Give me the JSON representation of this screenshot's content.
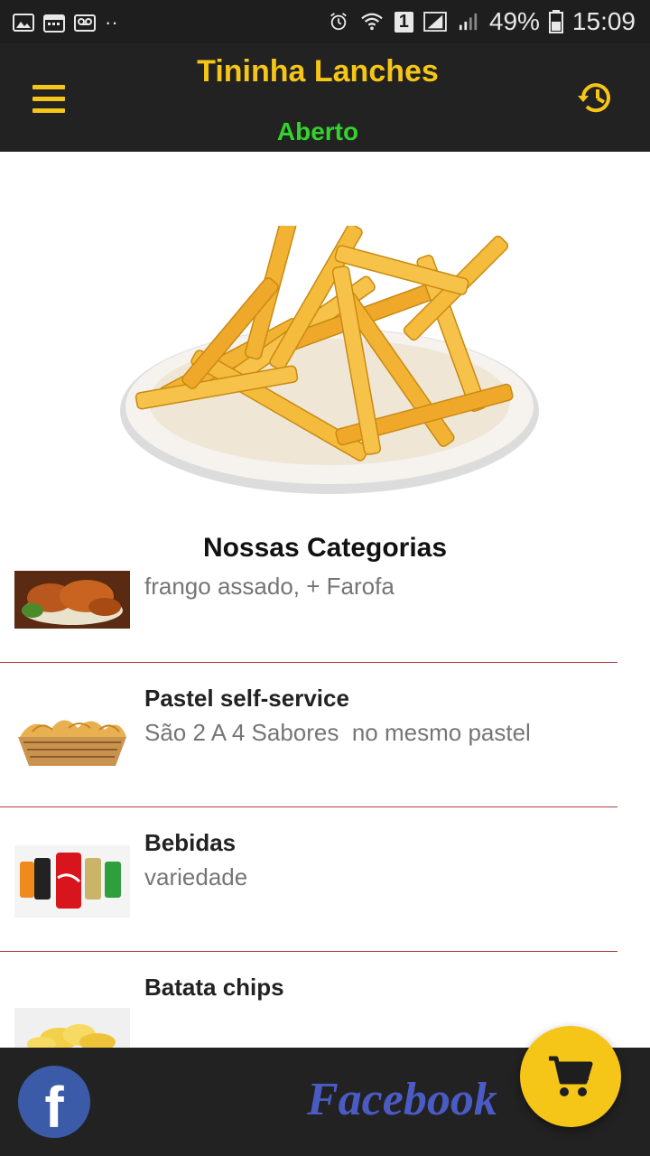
{
  "status_bar": {
    "battery": "49%",
    "time": "15:09",
    "sim_slot": "1"
  },
  "header": {
    "title": "Tininha Lanches",
    "status": "Aberto"
  },
  "hero": {
    "icon": "french-fries-image"
  },
  "section": {
    "title": "Nossas Categorias"
  },
  "categories": [
    {
      "name": "",
      "description": "frango assado, + Farofa",
      "thumb": "roast-chicken-image"
    },
    {
      "name": "Pastel self-service",
      "description": "São 2 A 4 Sabores  no mesmo pastel",
      "thumb": "pastel-basket-image"
    },
    {
      "name": "Bebidas",
      "description": "variedade",
      "thumb": "soda-cans-image"
    },
    {
      "name": "Batata chips",
      "description": "",
      "thumb": "potato-chips-image"
    }
  ],
  "bottom_bar": {
    "facebook_logo_letter": "f",
    "facebook_text": "Facebook"
  },
  "colors": {
    "accent": "#f5c518",
    "open_status": "#35d12c",
    "bar_background": "#222222",
    "facebook_blue": "#3b5ba8"
  }
}
